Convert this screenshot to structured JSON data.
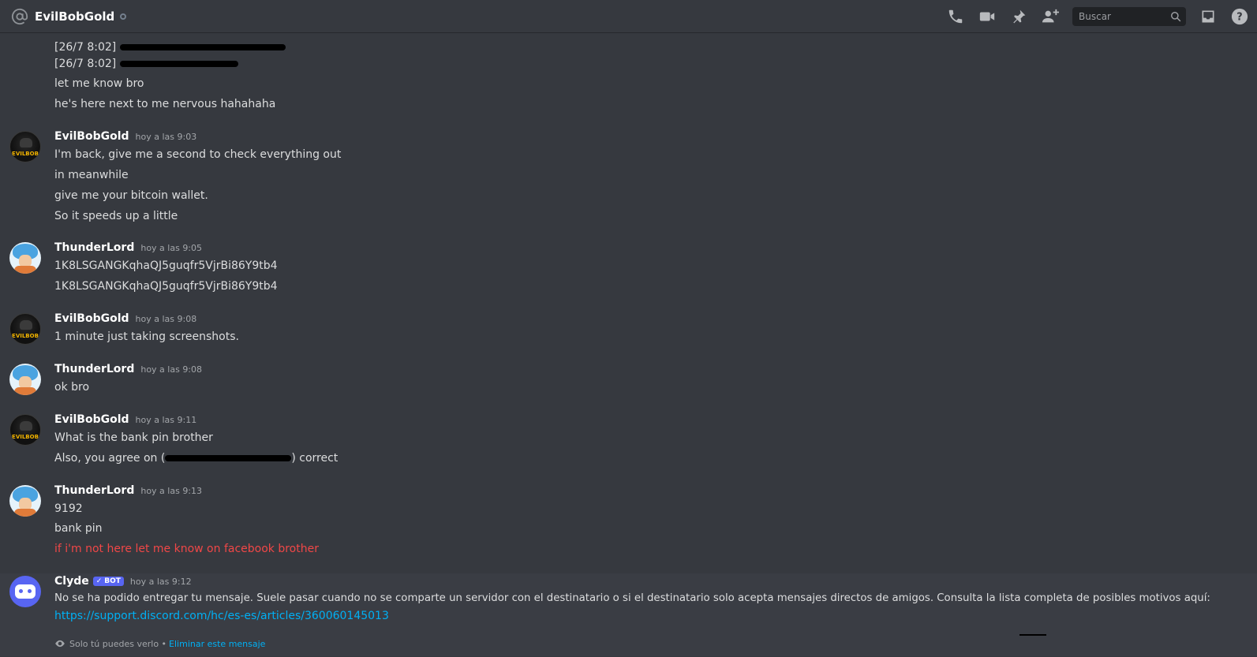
{
  "header": {
    "title": "EvilBobGold",
    "search_placeholder": "Buscar"
  },
  "messages": {
    "top_lines": [
      "[26/7 8:02]",
      "[26/7 8:02]",
      "let me know bro",
      "he's here next to me nervous hahahaha"
    ],
    "groups": [
      {
        "author": "EvilBobGold",
        "time": "hoy a las 9:03",
        "lines": [
          "I'm back, give me a second to check everything out",
          "in meanwhile",
          "give me your bitcoin wallet.",
          "So it speeds up a little"
        ]
      },
      {
        "author": "ThunderLord",
        "time": "hoy a las 9:05",
        "lines": [
          "1K8LSGANGKqhaQJ5guqfr5VjrBi86Y9tb4",
          "1K8LSGANGKqhaQJ5guqfr5VjrBi86Y9tb4"
        ]
      },
      {
        "author": "EvilBobGold",
        "time": "hoy a las 9:08",
        "lines": [
          "1 minute just taking screenshots."
        ]
      },
      {
        "author": "ThunderLord",
        "time": "hoy a las 9:08",
        "lines": [
          "ok bro"
        ]
      },
      {
        "author": "EvilBobGold",
        "time": "hoy a las 9:11",
        "lines": [
          "What is the bank pin brother",
          "Also, you agree on (",
          ") correct"
        ]
      },
      {
        "author": "ThunderLord",
        "time": "hoy a las 9:13",
        "lines": [
          "9192",
          "bank pin",
          "if i'm not here let me know on facebook brother"
        ]
      }
    ],
    "clyde": {
      "author": "Clyde",
      "badge": "BOT",
      "badge_check": "✓",
      "time": "hoy a las 9:12",
      "text": "No se ha podido entregar tu mensaje. Suele pasar cuando no se comparte un servidor con el destinatario o si el destinatario solo acepta mensajes directos de amigos. Consulta la lista completa de posibles motivos aquí:",
      "link": "https://support.discord.com/hc/es-es/articles/360060145013",
      "ephemeral_note": "Solo tú puedes verlo •",
      "delete_label": "Eliminar este mensaje"
    },
    "avatar_badge": "EVILBOB"
  },
  "colors": {
    "background": "#36393f",
    "link": "#00b0f4",
    "alert_text": "#f04747",
    "bot_badge": "#5865f2"
  }
}
